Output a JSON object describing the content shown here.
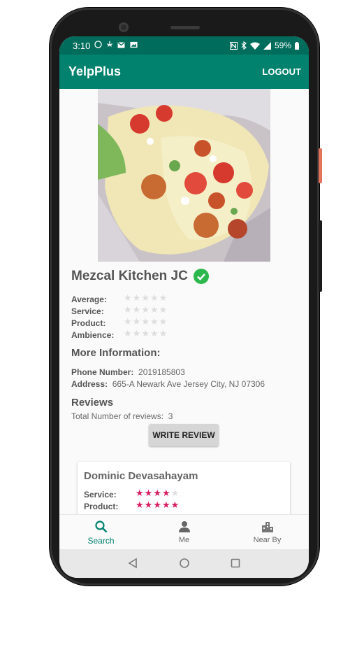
{
  "status_bar": {
    "time": "3:10",
    "battery": "59%"
  },
  "app_bar": {
    "title": "YelpPlus",
    "logout_label": "LOGOUT"
  },
  "business": {
    "name": "Mezcal Kitchen JC",
    "ratings": [
      {
        "label": "Average:",
        "stars": 0
      },
      {
        "label": "Service:",
        "stars": 0
      },
      {
        "label": "Product:",
        "stars": 0
      },
      {
        "label": "Ambience:",
        "stars": 0
      }
    ],
    "more_info_heading": "More Information:",
    "phone_label": "Phone Number:",
    "phone": "2019185803",
    "address_label": "Address:",
    "address": "665-A Newark Ave Jersey City, NJ 07306"
  },
  "reviews": {
    "heading": "Reviews",
    "total_label": "Total Number of reviews:",
    "total": "3",
    "write_button": "WRITE REVIEW",
    "items": [
      {
        "reviewer": "Dominic Devasahayam",
        "ratings": [
          {
            "label": "Service:",
            "stars": 4
          },
          {
            "label": "Product:",
            "stars": 5
          }
        ]
      }
    ]
  },
  "bottom_nav": {
    "items": [
      {
        "label": "Search",
        "icon": "search-icon",
        "active": true
      },
      {
        "label": "Me",
        "icon": "person-icon",
        "active": false
      },
      {
        "label": "Near By",
        "icon": "city-icon",
        "active": false
      }
    ]
  },
  "colors": {
    "status_bar": "#006d5c",
    "app_bar": "#00826f",
    "accent": "#00826f",
    "verified": "#2db84d",
    "review_star": "#d81b60",
    "empty_star": "#dddddd"
  }
}
